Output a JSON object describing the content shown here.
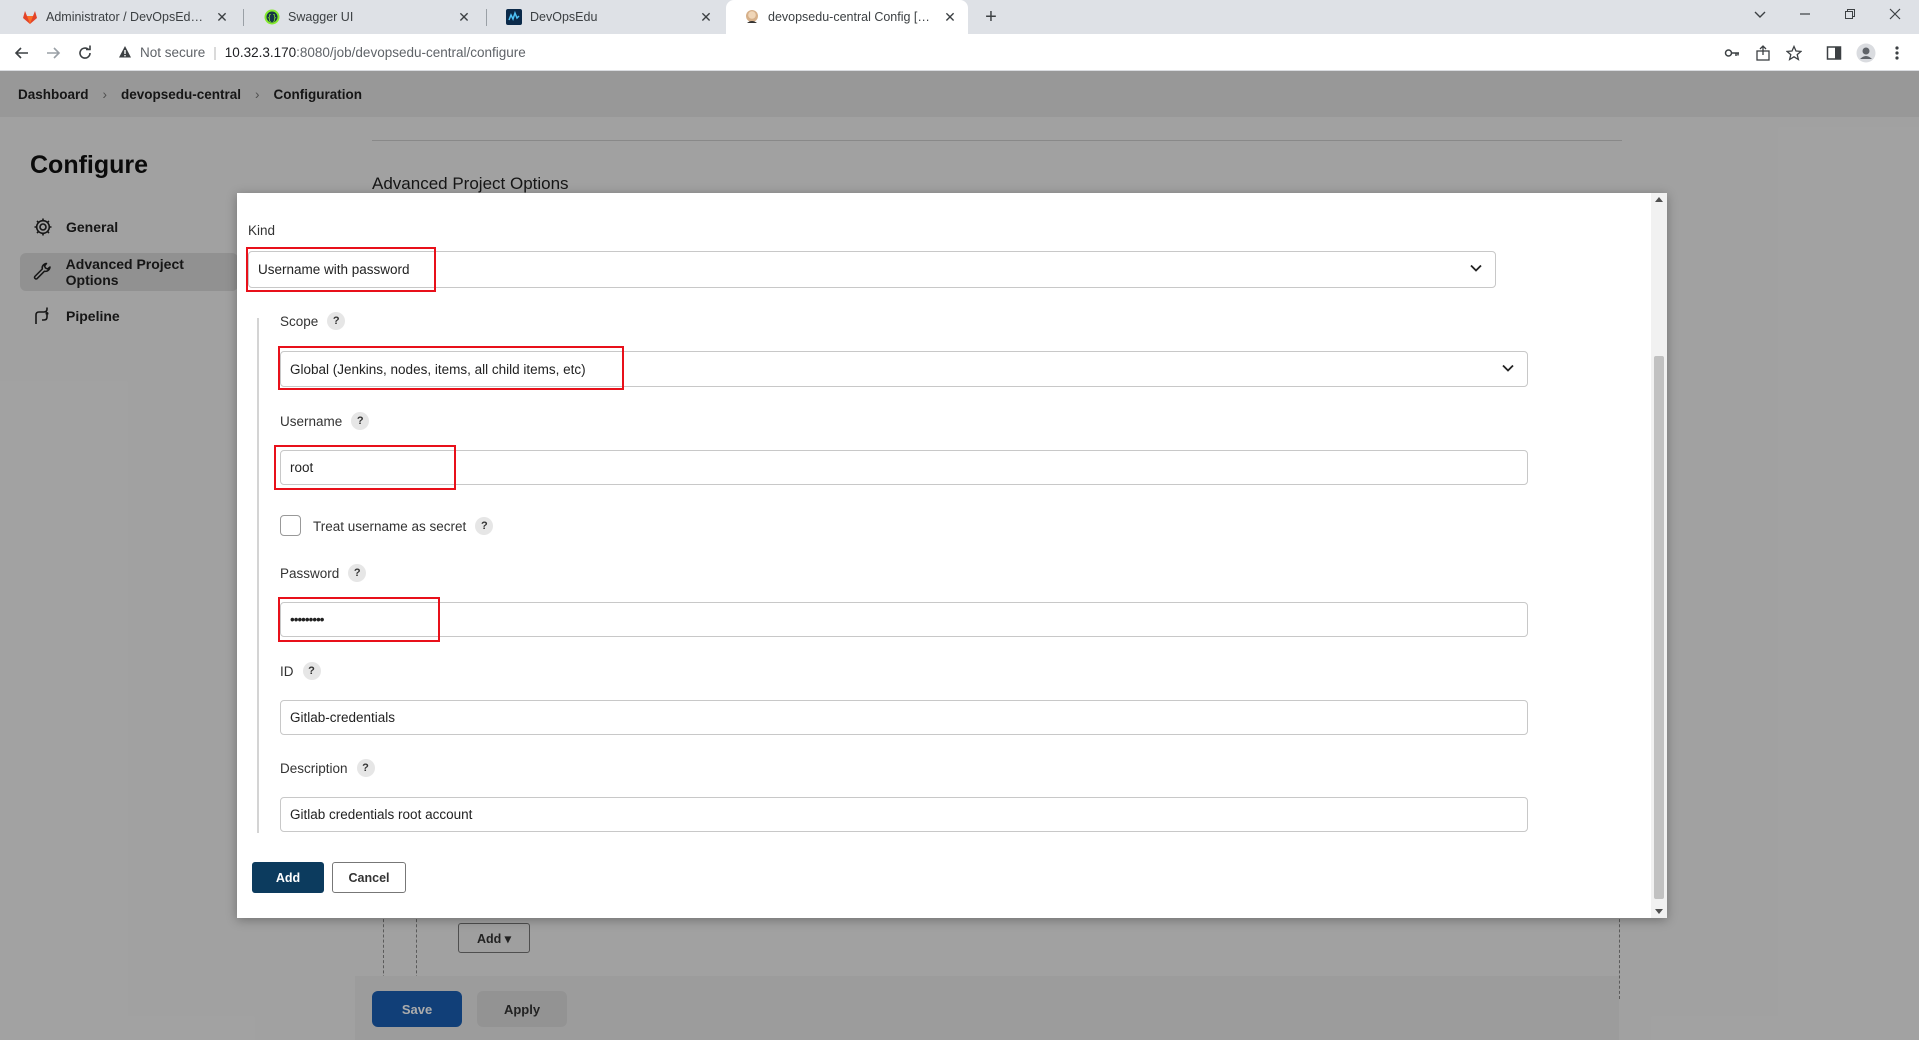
{
  "browser": {
    "tabs": [
      {
        "title": "Administrator / DevOpsEdu Cent",
        "favicon": "gitlab-icon"
      },
      {
        "title": "Swagger UI",
        "favicon": "swagger-icon"
      },
      {
        "title": "DevOpsEdu",
        "favicon": "devopsedu-icon"
      },
      {
        "title": "devopsedu-central Config [Jenki",
        "favicon": "jenkins-icon"
      }
    ],
    "active_tab": 3,
    "new_tab": "+",
    "security_label": "Not secure",
    "url_host": "10.32.3.170",
    "url_path": ":8080/job/devopsedu-central/configure"
  },
  "breadcrumb": [
    "Dashboard",
    "devopsedu-central",
    "Configuration"
  ],
  "sidebar": {
    "title": "Configure",
    "items": [
      {
        "label": "General",
        "icon": "gear-icon"
      },
      {
        "label": "Advanced Project Options",
        "icon": "wrench-icon"
      },
      {
        "label": "Pipeline",
        "icon": "pipeline-icon"
      }
    ],
    "selected": 1
  },
  "main": {
    "section_title": "Advanced Project Options",
    "under_add_label": "Add ▾",
    "save_label": "Save",
    "apply_label": "Apply"
  },
  "dialog": {
    "kind_label": "Kind",
    "kind_value": "Username with password",
    "scope_label": "Scope",
    "scope_value": "Global (Jenkins, nodes, items, all child items, etc)",
    "username_label": "Username",
    "username_value": "root",
    "treat_secret_label": "Treat username as secret",
    "password_label": "Password",
    "password_value": "•••••••••",
    "id_label": "ID",
    "id_value": "Gitlab-credentials",
    "description_label": "Description",
    "description_value": "Gitlab credentials root account",
    "help_glyph": "?",
    "add_label": "Add",
    "cancel_label": "Cancel"
  },
  "colors": {
    "highlight": "#e8101a",
    "primary_button": "#0c3b5e",
    "save_button": "#1a5fb4"
  }
}
